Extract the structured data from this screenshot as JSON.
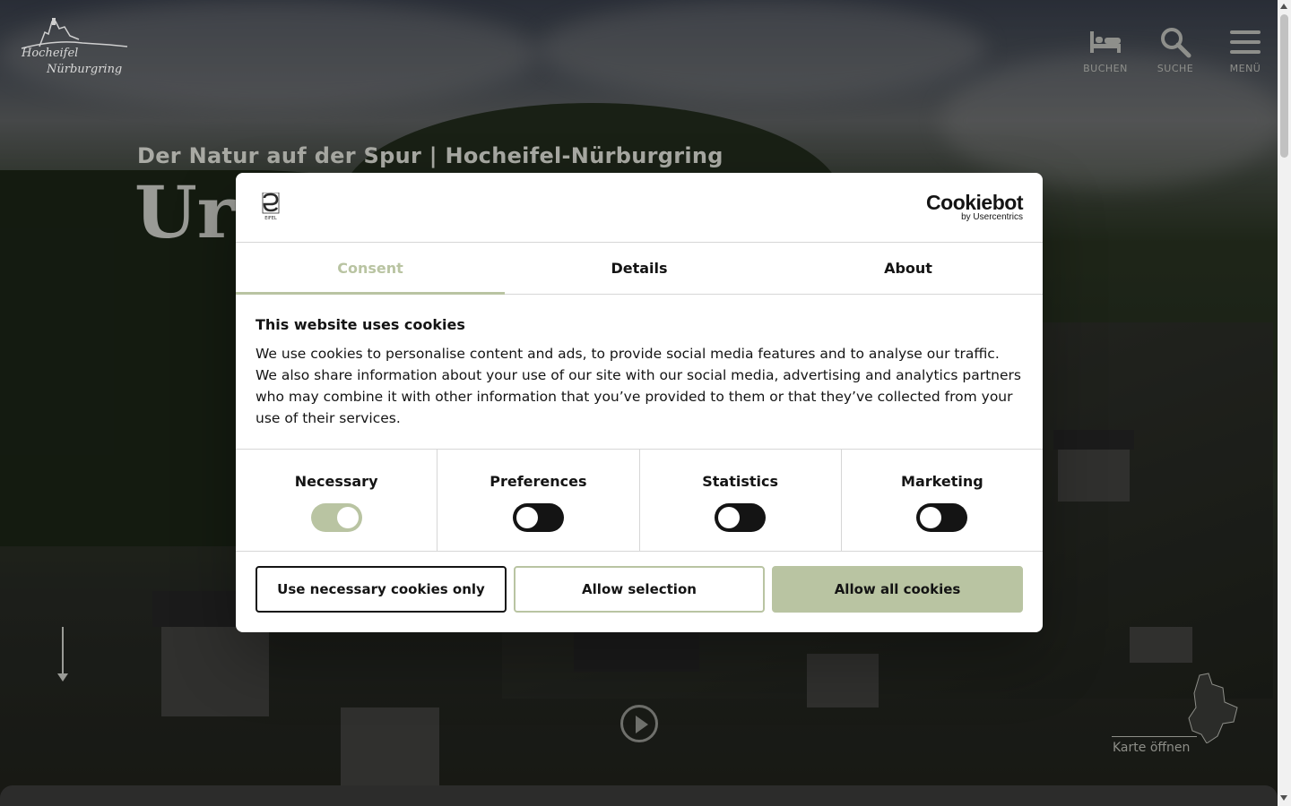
{
  "header": {
    "logo_line1": "Hocheifel",
    "logo_line2": "Nürburgring",
    "nav": [
      {
        "label": "BUCHEN",
        "icon": "bed-icon"
      },
      {
        "label": "SUCHE",
        "icon": "search-icon"
      },
      {
        "label": "MENÜ",
        "icon": "menu-icon"
      }
    ]
  },
  "hero": {
    "subtitle": "Der Natur auf der Spur | Hocheifel-Nürburgring",
    "title": "Urlaub"
  },
  "map": {
    "label": "Karte öffnen"
  },
  "cookie_dialog": {
    "brand_small": "EIFEL",
    "provider_name": "Cookiebot",
    "provider_sub": "by Usercentrics",
    "tabs": [
      {
        "label": "Consent",
        "active": true
      },
      {
        "label": "Details",
        "active": false
      },
      {
        "label": "About",
        "active": false
      }
    ],
    "heading": "This website uses cookies",
    "text": "We use cookies to personalise content and ads, to provide social media features and to analyse our traffic. We also share information about your use of our site with our social media, advertising and analytics partners who may combine it with other information that you’ve provided to them or that they’ve collected from your use of their services.",
    "categories": [
      {
        "label": "Necessary",
        "enabled": true
      },
      {
        "label": "Preferences",
        "enabled": false
      },
      {
        "label": "Statistics",
        "enabled": false
      },
      {
        "label": "Marketing",
        "enabled": false
      }
    ],
    "buttons": {
      "necessary_only": "Use necessary cookies only",
      "allow_selection": "Allow selection",
      "allow_all": "Allow all cookies"
    }
  },
  "colors": {
    "accent": "#b9c4a2",
    "text": "#141414",
    "toggle_off": "#141414"
  }
}
